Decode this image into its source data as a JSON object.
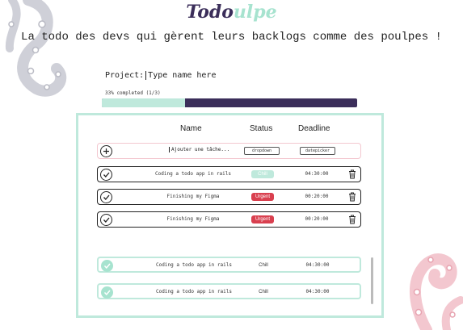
{
  "brand": {
    "part1": "Todo",
    "part2": "ulpe"
  },
  "tagline": "La todo des devs qui gèrent leurs backlogs comme des poulpes !",
  "project": {
    "label": "Project:",
    "placeholder": "Type name here"
  },
  "progress": {
    "label": "33% completed (1/3)",
    "fraction": 0.33
  },
  "columns": {
    "name": "Name",
    "status": "Status",
    "deadline": "Deadline"
  },
  "add_row": {
    "placeholder": "Ajouter une tâche...",
    "status_picker": "dropdown",
    "date_picker": "datepicker"
  },
  "tasks": [
    {
      "name": "Coding a todo app in rails",
      "status": "Chill",
      "deadline": "04:30:00"
    },
    {
      "name": "Finishing my Figma",
      "status": "Urgent",
      "deadline": "00:20:00"
    },
    {
      "name": "Finishing my Figma",
      "status": "Urgent",
      "deadline": "00:20:00"
    }
  ],
  "completed": [
    {
      "name": "Coding a todo app in rails",
      "status": "Chill",
      "deadline": "04:30:00"
    },
    {
      "name": "Coding a todo app in rails",
      "status": "Chill",
      "deadline": "04:30:00"
    }
  ],
  "colors": {
    "accent": "#bfe9dc",
    "primary": "#3b2e5a",
    "urgent": "#d9404f",
    "deco": "#f3c7cf"
  },
  "icons": {
    "add": "plus-circle-icon",
    "check": "check-circle-icon",
    "trash": "trash-icon"
  }
}
